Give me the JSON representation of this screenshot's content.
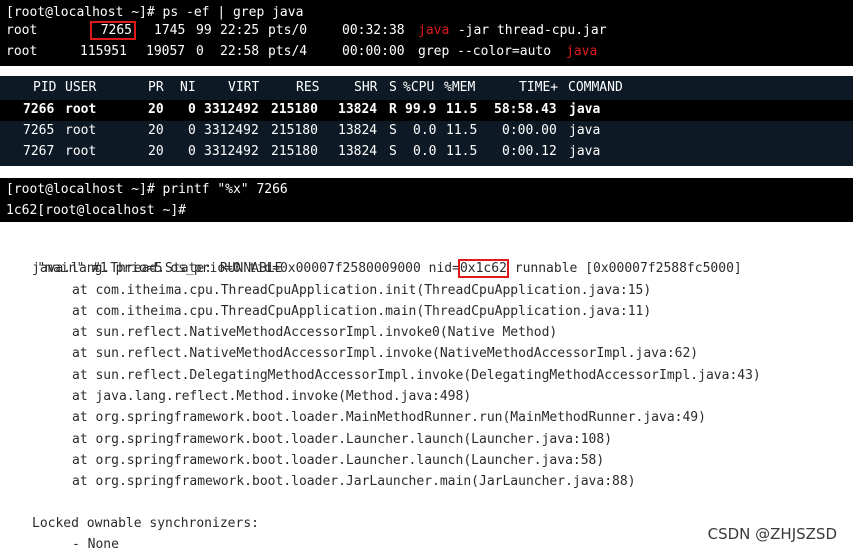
{
  "ps_panel": {
    "prompt": "[root@localhost ~]# ps -ef | grep java",
    "rows": [
      {
        "user": "root",
        "pid": "7265",
        "ppid": "1745",
        "c": "99",
        "stime": "22:25",
        "tty": "pts/0",
        "time": "00:32:38",
        "cmd_hl": "java",
        "cmd_rest": " -jar thread-cpu.jar"
      },
      {
        "user": "root",
        "pid": "115951",
        "ppid": "19057",
        "c": "0",
        "stime": "22:58",
        "tty": "pts/4",
        "time": "00:00:00",
        "cmd_pre": "grep --color=auto ",
        "cmd_hl": "java"
      }
    ]
  },
  "top_panel": {
    "headers": [
      "PID",
      "USER",
      "PR",
      "NI",
      "VIRT",
      "RES",
      "SHR",
      "S",
      "%CPU",
      "%MEM",
      "TIME+",
      "COMMAND"
    ],
    "rows": [
      [
        "7266",
        "root",
        "20",
        "0",
        "3312492",
        "215180",
        "13824",
        "R",
        "99.9",
        "11.5",
        "58:58.43",
        "java"
      ],
      [
        "7265",
        "root",
        "20",
        "0",
        "3312492",
        "215180",
        "13824",
        "S",
        "0.0",
        "11.5",
        "0:00.00",
        "java"
      ],
      [
        "7267",
        "root",
        "20",
        "0",
        "3312492",
        "215180",
        "13824",
        "S",
        "0.0",
        "11.5",
        "0:00.12",
        "java"
      ]
    ]
  },
  "printf_panel": {
    "line1": "[root@localhost ~]# printf \"%x\" 7266",
    "line2": "1c62[root@localhost ~]#"
  },
  "trace_panel": {
    "head_pre": "\"main\" #1 prio=5 os_prio=0 tid=0x00007f2580009000 nid=",
    "head_nid": "0x1c62",
    "head_post": " runnable [0x00007f2588fc5000]",
    "state": "java.lang.Thread.State: RUNNABLE",
    "frames": [
      "at com.itheima.cpu.ThreadCpuApplication.init(ThreadCpuApplication.java:15)",
      "at com.itheima.cpu.ThreadCpuApplication.main(ThreadCpuApplication.java:11)",
      "at sun.reflect.NativeMethodAccessorImpl.invoke0(Native Method)",
      "at sun.reflect.NativeMethodAccessorImpl.invoke(NativeMethodAccessorImpl.java:62)",
      "at sun.reflect.DelegatingMethodAccessorImpl.invoke(DelegatingMethodAccessorImpl.java:43)",
      "at java.lang.reflect.Method.invoke(Method.java:498)",
      "at org.springframework.boot.loader.MainMethodRunner.run(MainMethodRunner.java:49)",
      "at org.springframework.boot.loader.Launcher.launch(Launcher.java:108)",
      "at org.springframework.boot.loader.Launcher.launch(Launcher.java:58)",
      "at org.springframework.boot.loader.JarLauncher.main(JarLauncher.java:88)"
    ],
    "locked_label": "Locked ownable synchronizers:",
    "locked_value": "- None"
  },
  "watermark": "CSDN @ZHJSZSD",
  "colors": {
    "highlight": "#e01a1a",
    "terminal_bg": "#000000",
    "top_bg": "#0d1a26"
  }
}
